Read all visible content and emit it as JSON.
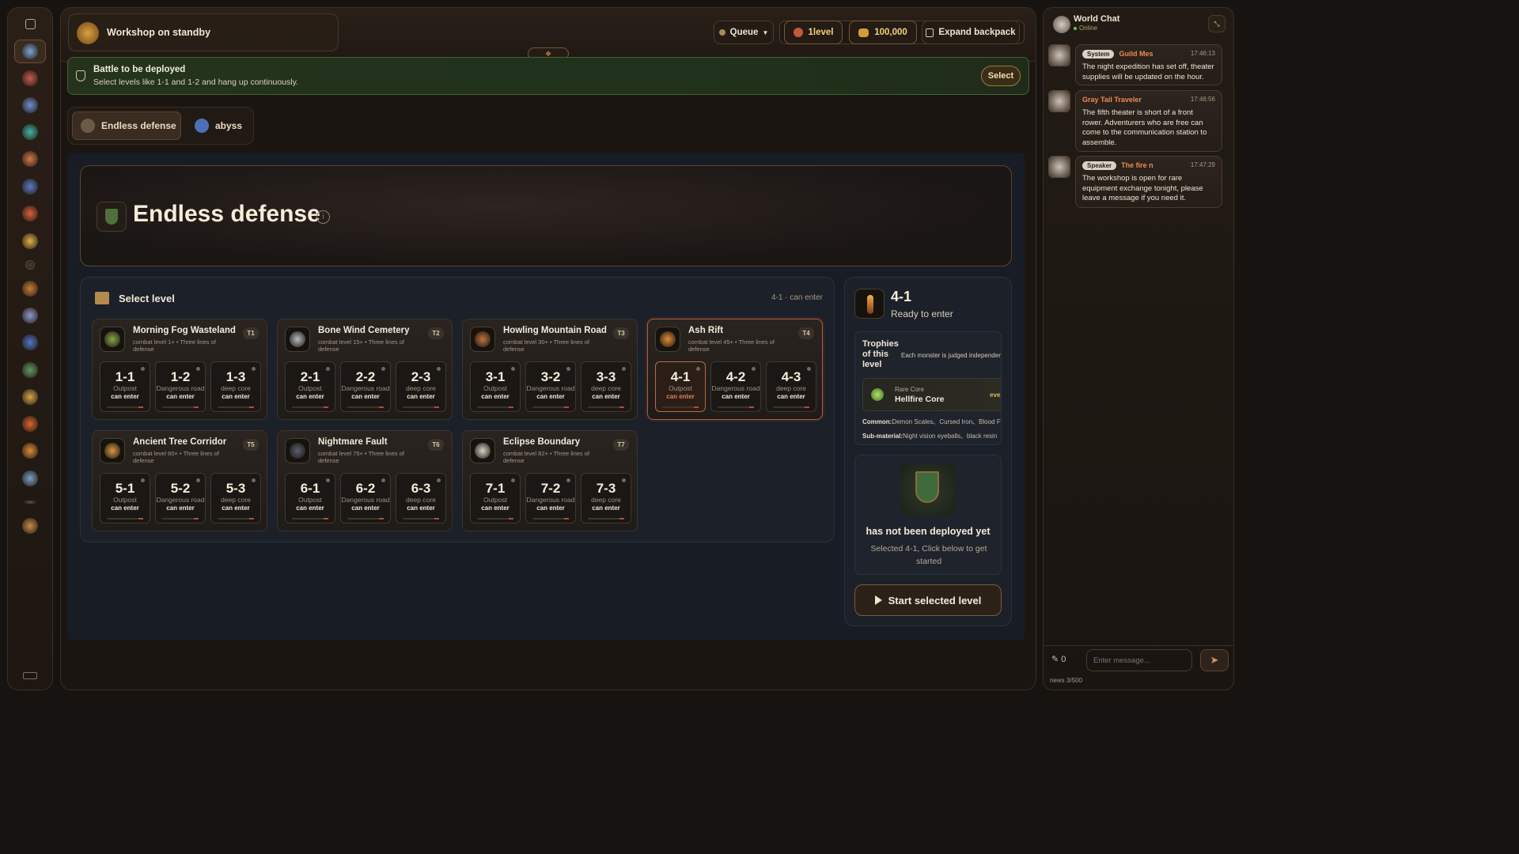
{
  "sidebar": {
    "items": [
      {
        "name": "nav-quill-icon",
        "color": "#7fa6d9",
        "active": true
      },
      {
        "name": "nav-blades-icon",
        "color": "#c45b4f"
      },
      {
        "name": "nav-swords-icon",
        "color": "#6e8fd0"
      },
      {
        "name": "nav-potion-icon",
        "color": "#3fb6a8"
      },
      {
        "name": "nav-wing-icon",
        "color": "#d07a4a"
      },
      {
        "name": "nav-orb-icon",
        "color": "#5a7bc7"
      },
      {
        "name": "nav-phoenix-icon",
        "color": "#d8603f"
      },
      {
        "name": "nav-sun-icon",
        "color": "#e0b24a"
      },
      {
        "name": "nav-ring-icon",
        "color": "#4b4036"
      },
      {
        "name": "nav-scroll-icon",
        "color": "#c67e3c"
      },
      {
        "name": "nav-wand-icon",
        "color": "#8a9bcf"
      },
      {
        "name": "nav-compass-icon",
        "color": "#4f76c8"
      },
      {
        "name": "nav-forest-icon",
        "color": "#5e9a63"
      },
      {
        "name": "nav-book-icon",
        "color": "#d7a44b"
      },
      {
        "name": "nav-fire-icon",
        "color": "#d6672e"
      },
      {
        "name": "nav-gem-icon",
        "color": "#e08a3a"
      },
      {
        "name": "nav-castle-icon",
        "color": "#7ba1c7"
      },
      {
        "name": "nav-divider-icon",
        "color": "#5e4b39"
      },
      {
        "name": "nav-gear-icon",
        "color": "#c48a4b"
      }
    ]
  },
  "topbar": {
    "workshop_label": "Workshop on standby",
    "queue_label": "Queue",
    "level_label": "1level",
    "gold_label": "100,000",
    "expand_label": "Expand backpack"
  },
  "banner": {
    "title": "Battle to be deployed",
    "subtitle": "Select levels like 1-1 and 1-2 and hang up continuously.",
    "select_label": "Select"
  },
  "tabs": [
    {
      "label": "Endless defense",
      "active": true
    },
    {
      "label": "abyss",
      "active": false
    }
  ],
  "hero": {
    "title": "Endless defense"
  },
  "levels": {
    "heading": "Select level",
    "status": "4-1 · can enter",
    "regions": [
      {
        "name": "Morning Fog Wasteland",
        "tier": "T1",
        "sub": "combat level 1+ • Three lines of defense",
        "icon": "#86a84a",
        "stages": [
          {
            "code": "1-1",
            "kind": "Outpost",
            "status": "can enter"
          },
          {
            "code": "1-2",
            "kind": "Dangerous road",
            "status": "can enter"
          },
          {
            "code": "1-3",
            "kind": "deep core",
            "status": "can enter"
          }
        ]
      },
      {
        "name": "Bone Wind Cemetery",
        "tier": "T2",
        "sub": "combat level 15+ • Three lines of defense",
        "icon": "#b8bcc4",
        "stages": [
          {
            "code": "2-1",
            "kind": "Outpost",
            "status": "can enter"
          },
          {
            "code": "2-2",
            "kind": "Dangerous road",
            "status": "can enter"
          },
          {
            "code": "2-3",
            "kind": "deep core",
            "status": "can enter"
          }
        ]
      },
      {
        "name": "Howling Mountain Road",
        "tier": "T3",
        "sub": "combat level 30+ • Three lines of defense",
        "icon": "#c0733e",
        "stages": [
          {
            "code": "3-1",
            "kind": "Outpost",
            "status": "can enter"
          },
          {
            "code": "3-2",
            "kind": "Dangerous road",
            "status": "can enter"
          },
          {
            "code": "3-3",
            "kind": "deep core",
            "status": "can enter"
          }
        ]
      },
      {
        "name": "Ash Rift",
        "tier": "T4",
        "sub": "combat level 45+ • Three lines of defense",
        "icon": "#e08f3a",
        "stages": [
          {
            "code": "4-1",
            "kind": "Outpost",
            "status": "can enter",
            "selected": true
          },
          {
            "code": "4-2",
            "kind": "Dangerous road",
            "status": "can enter"
          },
          {
            "code": "4-3",
            "kind": "deep core",
            "status": "can enter"
          }
        ]
      },
      {
        "name": "Ancient Tree Corridor",
        "tier": "T5",
        "sub": "combat level 60+ • Three lines of defense",
        "icon": "#d79a45",
        "stages": [
          {
            "code": "5-1",
            "kind": "Outpost",
            "status": "can enter"
          },
          {
            "code": "5-2",
            "kind": "Dangerous road",
            "status": "can enter"
          },
          {
            "code": "5-3",
            "kind": "deep core",
            "status": "can enter"
          }
        ]
      },
      {
        "name": "Nightmare Fault",
        "tier": "T6",
        "sub": "combat level 75+ • Three lines of defense",
        "icon": "#5a5f6b",
        "stages": [
          {
            "code": "6-1",
            "kind": "Outpost",
            "status": "can enter"
          },
          {
            "code": "6-2",
            "kind": "Dangerous road",
            "status": "can enter"
          },
          {
            "code": "6-3",
            "kind": "deep core",
            "status": "can enter"
          }
        ]
      },
      {
        "name": "Eclipse Boundary",
        "tier": "T7",
        "sub": "combat level 82+ • Three lines of defense",
        "icon": "#d9d3c6",
        "stages": [
          {
            "code": "7-1",
            "kind": "Outpost",
            "status": "can enter"
          },
          {
            "code": "7-2",
            "kind": "Dangerous road",
            "status": "can enter"
          },
          {
            "code": "7-3",
            "kind": "deep core",
            "status": "can enter"
          }
        ]
      }
    ]
  },
  "detail": {
    "code": "4-1",
    "status": "Ready to enter",
    "trophies_title": "Trophies of this level",
    "trophies_note": "Each monster is judged independently",
    "rare_kind": "Rare Core",
    "rare_name": "Hellfire Core",
    "rare_freq": "every m",
    "common_label": "Common:",
    "common_value": "Demon Scales、Cursed Iron、Blood Flame I",
    "sub_label": "Sub-material:",
    "sub_value": "Night vision eyeballs、black resin",
    "deploy_title": "has not been deployed yet",
    "deploy_text": "Selected 4-1, Click below to get started",
    "start_label": "Start selected level"
  },
  "chat": {
    "title": "World Chat",
    "online": "Online",
    "messages": [
      {
        "badge": "System",
        "sender": "Guild Mes",
        "time": "17:46:13",
        "text": "The night expedition has set off, theater supplies will be updated on the hour."
      },
      {
        "badge": "",
        "sender": "Gray Tail Traveler",
        "time": "17:46:56",
        "text": "The fifth theater is short of a front rower. Adventurers who are free can come to the communication station to assemble."
      },
      {
        "badge": "Speaker",
        "sender": "The fire n",
        "time": "17:47:29",
        "text": "The workshop is open for rare equipment exchange tonight, please leave a message if you need it."
      }
    ],
    "count": "0",
    "placeholder": "Enter message...",
    "news": "news 3/500"
  }
}
